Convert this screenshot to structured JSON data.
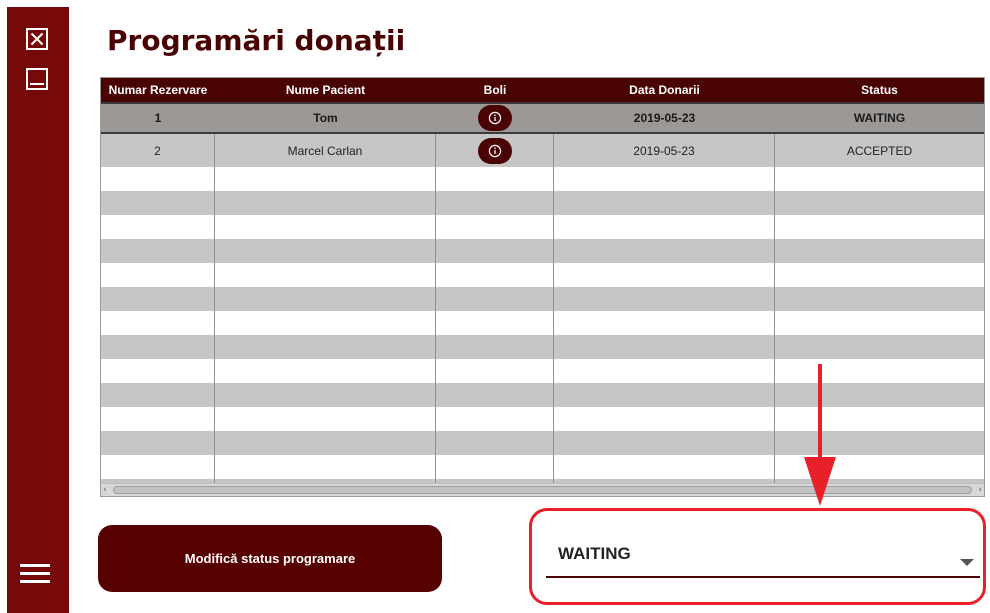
{
  "app": {
    "page_title": "Programări donații"
  },
  "sidebar": {
    "icons": [
      "close-icon",
      "minimize-icon",
      "menu-icon"
    ]
  },
  "table": {
    "columns": [
      "Numar Rezervare",
      "Nume Pacient",
      "Boli",
      "Data Donarii",
      "Status"
    ],
    "rows": [
      {
        "id": "1",
        "patient": "Tom",
        "boli_icon": "info-icon",
        "date": "2019-05-23",
        "status": "WAITING"
      },
      {
        "id": "2",
        "patient": "Marcel Carlan",
        "boli_icon": "info-icon",
        "date": "2019-05-23",
        "status": "ACCEPTED"
      }
    ]
  },
  "actions": {
    "modify_status_label": "Modifică status programare"
  },
  "status_select": {
    "selected": "WAITING",
    "options": [
      "WAITING"
    ]
  },
  "colors": {
    "sidebar": "#760909",
    "header": "#4a0303",
    "button": "#560000",
    "annotation": "#e8202a",
    "row_alt": "#c6c6c6",
    "row_selected": "#9c9896"
  }
}
